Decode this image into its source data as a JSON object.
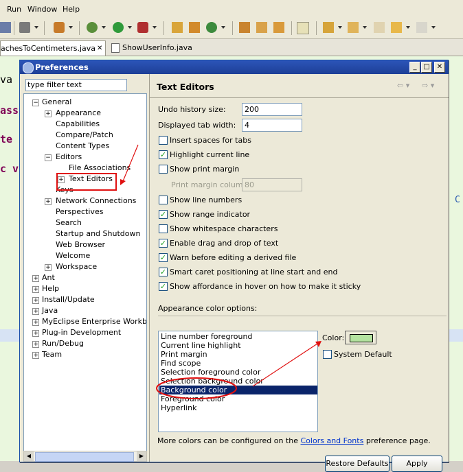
{
  "menubar": {
    "items": [
      "Run",
      "Window",
      "Help"
    ]
  },
  "editor_tabs": [
    {
      "label": "achesToCentimeters.java",
      "close": "✕"
    },
    {
      "label": "ShowUserInfo.java"
    }
  ],
  "editor_code": {
    "line1": "va",
    "line2": "ass",
    "line3": "te",
    "line4": "c v",
    "right_char": "C"
  },
  "dialog": {
    "title": "Preferences",
    "filter_placeholder": "type filter text",
    "tree": {
      "general": "General",
      "appearance": "Appearance",
      "capabilities": "Capabilities",
      "compare_patch": "Compare/Patch",
      "content_types": "Content Types",
      "editors": "Editors",
      "file_associations": "File Associations",
      "text_editors": "Text Editors",
      "keys": "Keys",
      "network_connections": "Network Connections",
      "perspectives": "Perspectives",
      "search": "Search",
      "startup_shutdown": "Startup and Shutdown",
      "web_browser": "Web Browser",
      "welcome": "Welcome",
      "workspace": "Workspace",
      "ant": "Ant",
      "help": "Help",
      "install_update": "Install/Update",
      "java": "Java",
      "myeclipse": "MyEclipse Enterprise Workbenc",
      "plugin_dev": "Plug-in Development",
      "run_debug": "Run/Debug",
      "team": "Team"
    },
    "page": {
      "title": "Text Editors",
      "undo_label": "Undo history size:",
      "undo_value": "200",
      "tab_width_label": "Displayed tab width:",
      "tab_width_value": "4",
      "checkboxes": [
        {
          "label": "Insert spaces for tabs",
          "checked": false
        },
        {
          "label": "Highlight current line",
          "checked": true
        },
        {
          "label": "Show print margin",
          "checked": false
        },
        {
          "label": "Show line numbers",
          "checked": false
        },
        {
          "label": "Show range indicator",
          "checked": true
        },
        {
          "label": "Show whitespace characters",
          "checked": false
        },
        {
          "label": "Enable drag and drop of text",
          "checked": true
        },
        {
          "label": "Warn before editing a derived file",
          "checked": true
        },
        {
          "label": "Smart caret positioning at line start and end",
          "checked": true
        },
        {
          "label": "Show affordance in hover on how to make it sticky",
          "checked": true
        }
      ],
      "print_margin_label": "Print margin column:",
      "print_margin_value": "80",
      "appearance_label": "Appearance color options:",
      "color_options": [
        "Line number foreground",
        "Current line highlight",
        "Print margin",
        "Find scope",
        "Selection foreground color",
        "Selection background color",
        "Background color",
        "Foreground color",
        "Hyperlink"
      ],
      "selected_color_option": "Background color",
      "color_label": "Color:",
      "color_value": "#b4e3a0",
      "system_default_label": "System Default",
      "more_colors_prefix": "More colors can be configured on the",
      "more_colors_link": "Colors and Fonts",
      "more_colors_suffix": "preference page.",
      "restore_defaults": "Restore Defaults",
      "apply": "Apply"
    }
  },
  "colors": {
    "title_bar": "#1d3f97",
    "annotation_red": "#e01010",
    "selection": "#0a246a"
  }
}
